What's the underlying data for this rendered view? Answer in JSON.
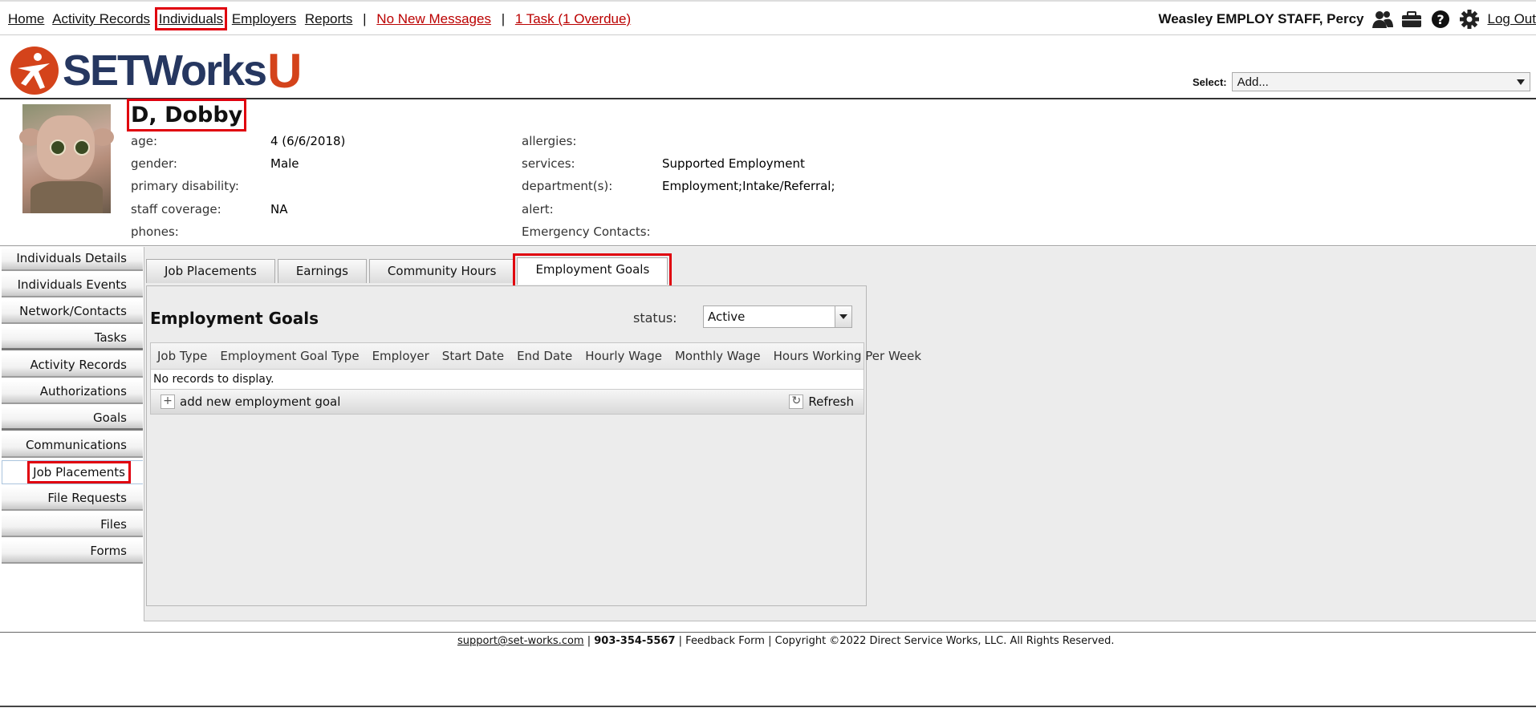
{
  "nav": {
    "home": "Home",
    "activity_records": "Activity Records",
    "individuals": "Individuals",
    "employers": "Employers",
    "reports": "Reports",
    "sep": "|",
    "messages": "No New Messages",
    "tasks": "1 Task (1 Overdue)"
  },
  "user": {
    "name": "Weasley EMPLOY STAFF, Percy",
    "logout": "Log Out"
  },
  "logo": {
    "word": "SETWorks",
    "u": "U"
  },
  "select": {
    "label": "Select:",
    "value": "Add..."
  },
  "person": {
    "name": "D, Dobby",
    "left": [
      {
        "label": "age:",
        "value": "4 (6/6/2018)"
      },
      {
        "label": "gender:",
        "value": "Male"
      },
      {
        "label": "primary disability:",
        "value": ""
      },
      {
        "label": "staff coverage:",
        "value": "NA"
      },
      {
        "label": "phones:",
        "value": ""
      }
    ],
    "right": [
      {
        "label": "allergies:",
        "value": ""
      },
      {
        "label": "services:",
        "value": "Supported Employment"
      },
      {
        "label": "department(s):",
        "value": "Employment;Intake/Referral;"
      },
      {
        "label": "alert:",
        "value": ""
      },
      {
        "label": "Emergency Contacts:",
        "value": ""
      }
    ]
  },
  "sidebar": {
    "items": [
      "Individuals Details",
      "Individuals Events",
      "Network/Contacts",
      "Tasks",
      "Activity Records",
      "Authorizations",
      "Goals",
      "Communications",
      "Job Placements",
      "File Requests",
      "Files",
      "Forms"
    ]
  },
  "tabs": [
    "Job Placements",
    "Earnings",
    "Community Hours",
    "Employment Goals"
  ],
  "panel": {
    "title": "Employment Goals",
    "status_label": "status:",
    "status_value": "Active",
    "columns": [
      "Job Type",
      "Employment Goal Type",
      "Employer",
      "Start Date",
      "End Date",
      "Hourly Wage",
      "Monthly Wage",
      "Hours Working Per Week"
    ],
    "empty": "No records to display.",
    "add_label": "add new employment goal",
    "refresh_label": "Refresh"
  },
  "footer": {
    "email": "support@set-works.com",
    "phone": "903-354-5567",
    "feedback": "Feedback Form",
    "copyright": "Copyright ©2022 Direct Service Works, LLC. All Rights Reserved."
  },
  "colors": {
    "brand_blue": "#263760",
    "brand_orange": "#d4431b",
    "highlight": "#e0000e",
    "link_red": "#bb0000"
  }
}
